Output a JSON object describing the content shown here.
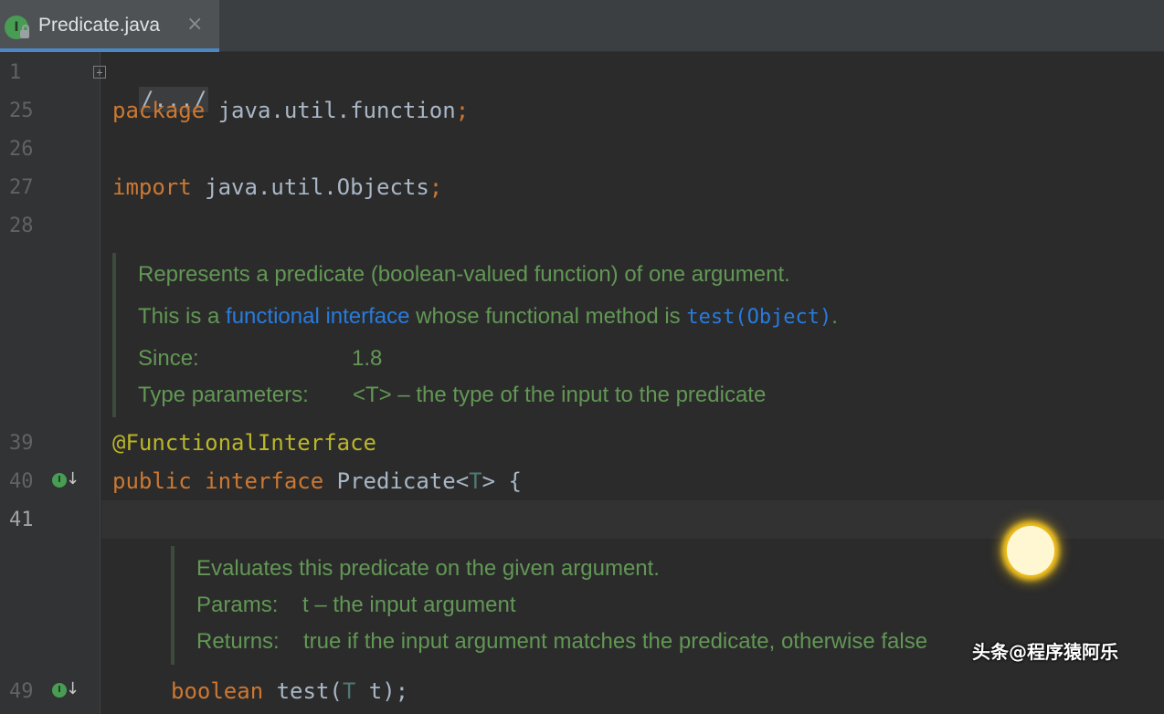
{
  "tab": {
    "title": "Predicate.java",
    "close_glyph": "×",
    "icon": "interface-icon",
    "icon_letter": "I"
  },
  "gutter": {
    "line_numbers": [
      "1",
      "25",
      "26",
      "27",
      "28",
      "39",
      "40",
      "41",
      "49"
    ],
    "fold_glyph": "+",
    "impl_glyph": "I",
    "impl_arrow": "↓"
  },
  "code": {
    "fold_text": "/.../",
    "package_kw": "package",
    "package_name": " java.util.function",
    "import_kw": "import",
    "import_name": " java.util.Objects",
    "semicolon": ";",
    "annotation": "@FunctionalInterface",
    "public_kw": "public",
    "interface_kw": "interface",
    "class_name": " Predicate<",
    "type_param": "T",
    "class_tail": "> {",
    "boolean_kw": "boolean",
    "method_open": " test(",
    "method_tail": " t);"
  },
  "doc1": {
    "line1": "Represents a predicate (boolean-valued function) of one argument.",
    "line2_prefix": "This is a ",
    "line2_link1": "functional interface",
    "line2_mid": " whose functional method is ",
    "line2_link2": "test(Object)",
    "line2_suffix": ".",
    "since_label": "Since:",
    "since_value": "1.8",
    "type_params_label": "Type parameters:",
    "type_params_value": "<T> – the type of the input to the predicate"
  },
  "doc2": {
    "line1": "Evaluates this predicate on the given argument.",
    "params_label": "Params:",
    "params_value": "t – the input argument",
    "returns_label": "Returns:",
    "returns_value": "true if the input argument matches the predicate, otherwise false"
  },
  "watermark": "头条@程序猿阿乐",
  "colors": {
    "background": "#2b2b2b",
    "keyword": "#cc7832",
    "annotation": "#bbb529",
    "doc_text": "#629755",
    "doc_link": "#287bde",
    "tab_accent": "#4a88c7"
  }
}
